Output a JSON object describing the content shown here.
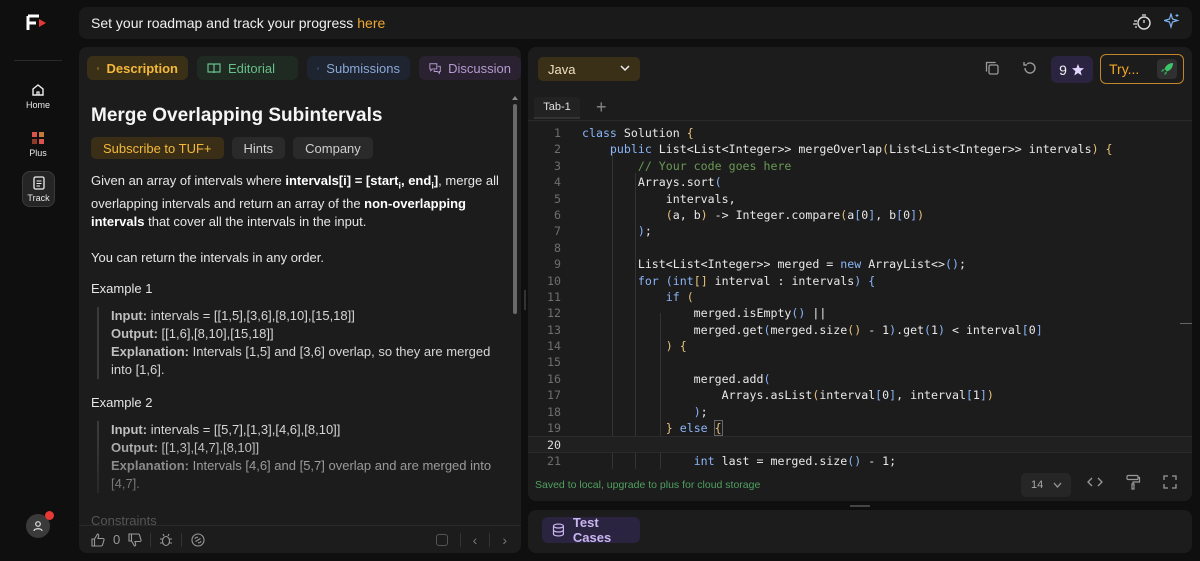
{
  "nav": {
    "items": [
      {
        "label": "Home",
        "icon": "home-icon"
      },
      {
        "label": "Plus",
        "icon": "plus-grid-icon"
      },
      {
        "label": "Track",
        "icon": "track-document-icon"
      }
    ]
  },
  "banner": {
    "text": "Set your roadmap and track your progress",
    "link": "here"
  },
  "problem": {
    "tabs": [
      "Description",
      "Editorial",
      "Submissions",
      "Discussion"
    ],
    "title": "Merge Overlapping Subintervals",
    "chips": [
      "Subscribe to TUF+",
      "Hints",
      "Company"
    ],
    "desc_1": "Given an array of intervals where ",
    "desc_bold_1": "intervals[i] = [start",
    "desc_sub_1": "i",
    "desc_bold_2": ", end",
    "desc_sub_2": "i",
    "desc_bold_3": "]",
    "desc_2": ", merge all overlapping intervals and return an array of the ",
    "desc_bold_4": "non-overlapping intervals",
    "desc_3": " that cover all the intervals in the input.",
    "desc_any_order": "You can return the intervals in any order.",
    "examples": [
      {
        "heading": "Example 1",
        "input_label": "Input:",
        "input": " intervals = [[1,5],[3,6],[8,10],[15,18]]",
        "output_label": "Output:",
        "output": " [[1,6],[8,10],[15,18]]",
        "explanation_label": "Explanation:",
        "explanation": " Intervals [1,5] and [3,6] overlap, so they are merged into [1,6]."
      },
      {
        "heading": "Example 2",
        "input_label": "Input:",
        "input": " intervals = [[5,7],[1,3],[4,6],[8,10]]",
        "output_label": "Output:",
        "output": " [[1,3],[4,7],[8,10]]",
        "explanation_label": "Explanation:",
        "explanation": " Intervals [4,6] and [5,7] overlap and are merged into [4,7]."
      }
    ],
    "constraints_heading": "Constraints",
    "likes": "0"
  },
  "editor": {
    "language": "Java",
    "streak": "9",
    "try_label": "Try...",
    "file_tab": "Tab-1",
    "saved_note": "Saved to local, upgrade to plus for cloud storage",
    "font_size": "14",
    "current_line": 20
  },
  "test_cases": {
    "label": "Test Cases"
  },
  "colors": {
    "accent_orange": "#f5b93a",
    "success_green": "#4fa061",
    "purple": "#c9b6f0"
  }
}
